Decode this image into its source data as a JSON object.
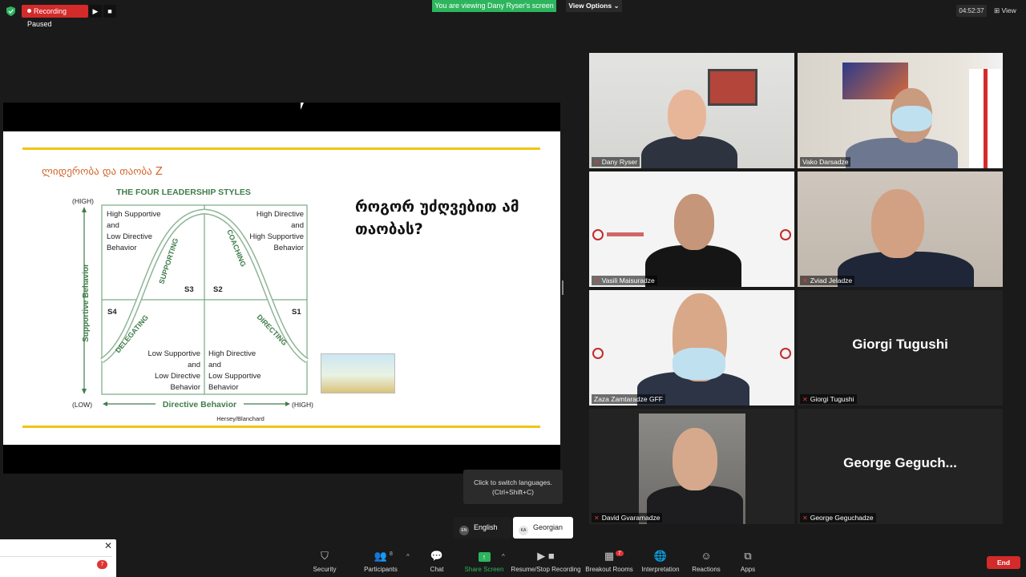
{
  "topbar": {
    "recording_label": "Recording Paused",
    "viewing_banner": "You are viewing Dany Ryser's screen",
    "view_options": "View Options",
    "clock": "04:52:37",
    "view_label": "View"
  },
  "slide": {
    "title": "ლიდერობა და თაობა Z",
    "question": "როგორ უძღვებით ამ თაობას?",
    "chart_data": {
      "type": "diagram",
      "title": "THE FOUR LEADERSHIP STYLES",
      "ylabel": "Supportive Behavior",
      "xlabel": "Directive Behavior",
      "y_high": "(HIGH)",
      "y_low": "(LOW)",
      "x_high": "(HIGH)",
      "credit": "Hersey/Blanchard",
      "quadrants": [
        {
          "id": "S3",
          "style": "SUPPORTING",
          "text": "High Supportive and Low Directive Behavior"
        },
        {
          "id": "S2",
          "style": "COACHING",
          "text": "High Directive and High Supportive Behavior"
        },
        {
          "id": "S4",
          "style": "DELEGATING",
          "text": "Low Supportive and Low Directive Behavior"
        },
        {
          "id": "S1",
          "style": "DIRECTING",
          "text": "High Directive and Low Supportive Behavior"
        }
      ]
    }
  },
  "participants": [
    {
      "name": "Dany Ryser",
      "video": true
    },
    {
      "name": "Vako Darsadze",
      "video": true
    },
    {
      "name": "Vasili Maisuradze",
      "video": true,
      "active_speaker": true
    },
    {
      "name": "Zviad Jeladze",
      "video": true
    },
    {
      "name": "Zaza Zamtaradze GFF",
      "video": true
    },
    {
      "name": "Giorgi Tugushi",
      "video": false,
      "display": "Giorgi Tugushi"
    },
    {
      "name": "David Gvaramadze",
      "video": true
    },
    {
      "name": "George Geguchadze",
      "video": false,
      "display": "George  Geguch..."
    }
  ],
  "tooltip": {
    "line1": "Click to switch languages.",
    "line2": "(Ctrl+Shift+C)"
  },
  "languages": [
    {
      "code": "EN",
      "label": "English",
      "selected": false
    },
    {
      "code": "KA",
      "label": "Georgian",
      "selected": true
    }
  ],
  "popup": {
    "badge": "7"
  },
  "toolbar": {
    "security": "Security",
    "participants": "Participants",
    "participants_count": "8",
    "chat": "Chat",
    "share_screen": "Share Screen",
    "resume_stop": "Resume/Stop Recording",
    "breakout": "Breakout Rooms",
    "breakout_badge": "7",
    "interpretation": "Interpretation",
    "reactions": "Reactions",
    "apps": "Apps",
    "end": "End"
  },
  "colors": {
    "accent_green": "#2db55d",
    "record_red": "#d32a2a",
    "slide_rule": "#f2c414",
    "diagram_green": "#3f7d4a",
    "title_orange": "#d1652a"
  }
}
